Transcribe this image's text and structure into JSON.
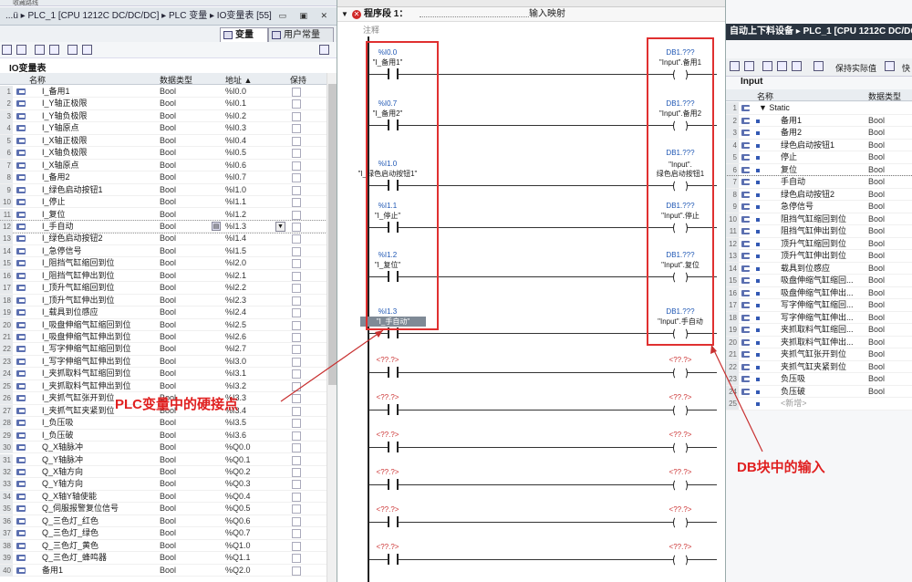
{
  "left_panel": {
    "top_text": "收藏路线",
    "breadcrumb": "...ü ▸ PLC_1 [CPU 1212C DC/DC/DC] ▸ PLC 变量 ▸ IO变量表 [55]",
    "tabs": [
      "变量",
      "用户常量"
    ],
    "table_title": "IO变量表",
    "columns": [
      "名称",
      "数据类型",
      "地址 ▲",
      "保持"
    ],
    "rows": [
      {
        "n": "1",
        "name": "I_备用1",
        "type": "Bool",
        "addr": "%I0.0"
      },
      {
        "n": "2",
        "name": "I_Y轴正极限",
        "type": "Bool",
        "addr": "%I0.1"
      },
      {
        "n": "3",
        "name": "I_Y轴负极限",
        "type": "Bool",
        "addr": "%I0.2"
      },
      {
        "n": "4",
        "name": "I_Y轴原点",
        "type": "Bool",
        "addr": "%I0.3"
      },
      {
        "n": "5",
        "name": "I_X轴正极限",
        "type": "Bool",
        "addr": "%I0.4"
      },
      {
        "n": "6",
        "name": "I_X轴负极限",
        "type": "Bool",
        "addr": "%I0.5"
      },
      {
        "n": "7",
        "name": "I_X轴原点",
        "type": "Bool",
        "addr": "%I0.6"
      },
      {
        "n": "8",
        "name": "I_备用2",
        "type": "Bool",
        "addr": "%I0.7"
      },
      {
        "n": "9",
        "name": "I_绿色启动按钮1",
        "type": "Bool",
        "addr": "%I1.0"
      },
      {
        "n": "10",
        "name": "I_停止",
        "type": "Bool",
        "addr": "%I1.1"
      },
      {
        "n": "11",
        "name": "I_复位",
        "type": "Bool",
        "addr": "%I1.2"
      },
      {
        "n": "12",
        "name": "I_手自动",
        "type": "Bool",
        "addr": "%I1.3"
      },
      {
        "n": "13",
        "name": "I_绿色启动按钮2",
        "type": "Bool",
        "addr": "%I1.4"
      },
      {
        "n": "14",
        "name": "I_急停信号",
        "type": "Bool",
        "addr": "%I1.5"
      },
      {
        "n": "15",
        "name": "I_阻挡气缸缩回到位",
        "type": "Bool",
        "addr": "%I2.0"
      },
      {
        "n": "16",
        "name": "I_阻挡气缸伸出到位",
        "type": "Bool",
        "addr": "%I2.1"
      },
      {
        "n": "17",
        "name": "I_顶升气缸缩回到位",
        "type": "Bool",
        "addr": "%I2.2"
      },
      {
        "n": "18",
        "name": "I_顶升气缸伸出到位",
        "type": "Bool",
        "addr": "%I2.3"
      },
      {
        "n": "19",
        "name": "I_载具到位感应",
        "type": "Bool",
        "addr": "%I2.4"
      },
      {
        "n": "20",
        "name": "I_吸盘伸缩气缸缩回到位",
        "type": "Bool",
        "addr": "%I2.5"
      },
      {
        "n": "21",
        "name": "I_吸盘伸缩气缸伸出到位",
        "type": "Bool",
        "addr": "%I2.6"
      },
      {
        "n": "22",
        "name": "I_写字伸缩气缸缩回到位",
        "type": "Bool",
        "addr": "%I2.7"
      },
      {
        "n": "23",
        "name": "I_写字伸缩气缸伸出到位",
        "type": "Bool",
        "addr": "%I3.0"
      },
      {
        "n": "24",
        "name": "I_夹抓取料气缸缩回到位",
        "type": "Bool",
        "addr": "%I3.1"
      },
      {
        "n": "25",
        "name": "I_夹抓取料气缸伸出到位",
        "type": "Bool",
        "addr": "%I3.2"
      },
      {
        "n": "26",
        "name": "I_夹抓气缸张开到位",
        "type": "Bool",
        "addr": "%I3.3"
      },
      {
        "n": "27",
        "name": "I_夹抓气缸夹紧到位",
        "type": "Bool",
        "addr": "%I3.4"
      },
      {
        "n": "28",
        "name": "I_负压吸",
        "type": "Bool",
        "addr": "%I3.5"
      },
      {
        "n": "29",
        "name": "I_负压破",
        "type": "Bool",
        "addr": "%I3.6"
      },
      {
        "n": "30",
        "name": "Q_X轴脉冲",
        "type": "Bool",
        "addr": "%Q0.0"
      },
      {
        "n": "31",
        "name": "Q_Y轴脉冲",
        "type": "Bool",
        "addr": "%Q0.1"
      },
      {
        "n": "32",
        "name": "Q_X轴方向",
        "type": "Bool",
        "addr": "%Q0.2"
      },
      {
        "n": "33",
        "name": "Q_Y轴方向",
        "type": "Bool",
        "addr": "%Q0.3"
      },
      {
        "n": "34",
        "name": "Q_X轴Y轴使能",
        "type": "Bool",
        "addr": "%Q0.4"
      },
      {
        "n": "35",
        "name": "Q_伺服报警复位信号",
        "type": "Bool",
        "addr": "%Q0.5"
      },
      {
        "n": "36",
        "name": "Q_三色灯_红色",
        "type": "Bool",
        "addr": "%Q0.6"
      },
      {
        "n": "37",
        "name": "Q_三色灯_绿色",
        "type": "Bool",
        "addr": "%Q0.7"
      },
      {
        "n": "38",
        "name": "Q_三色灯_黄色",
        "type": "Bool",
        "addr": "%Q1.0"
      },
      {
        "n": "39",
        "name": "Q_三色灯_蜂鸣器",
        "type": "Bool",
        "addr": "%Q1.1"
      },
      {
        "n": "40",
        "name": "备用1",
        "type": "Bool",
        "addr": "%Q2.0"
      }
    ]
  },
  "editor": {
    "segment_title": "程序段 1：",
    "segment_comment": "输入映射",
    "comment_label": "注释",
    "rungs": [
      {
        "addr": "%I0.0",
        "tag": "\"I_备用1\"",
        "db": "DB1.???",
        "coil": "\"Input\".备用1"
      },
      {
        "addr": "%I0.7",
        "tag": "\"I_备用2\"",
        "db": "DB1.???",
        "coil": "\"Input\".备用2"
      },
      {
        "addr": "%I1.0",
        "tag": "\"I_绿色启动按钮1\"",
        "db": "DB1.???",
        "coil": "\"Input\".\n绿色启动按钮1"
      },
      {
        "addr": "%I1.1",
        "tag": "\"I_停止\"",
        "db": "DB1.???",
        "coil": "\"Input\".停止"
      },
      {
        "addr": "%I1.2",
        "tag": "\"I_复位\"",
        "db": "DB1.???",
        "coil": "\"Input\".复位"
      },
      {
        "addr": "%I1.3",
        "tag": "\"I_手自动\"",
        "db": "DB1.???",
        "coil": "\"Input\".手自动"
      }
    ],
    "placeholder": "<??.?>"
  },
  "right_panel": {
    "header": "自动上下料设备 ▸ PLC_1 [CPU 1212C DC/DC",
    "toolbar_text": "保持实际值",
    "toolbar_text2": "快",
    "table_title": "Input",
    "columns": [
      "名称",
      "数据类型"
    ],
    "rows": [
      {
        "n": "1",
        "name": "▼ Static",
        "type": ""
      },
      {
        "n": "2",
        "name": "备用1",
        "type": "Bool"
      },
      {
        "n": "3",
        "name": "备用2",
        "type": "Bool"
      },
      {
        "n": "4",
        "name": "绿色启动按钮1",
        "type": "Bool"
      },
      {
        "n": "5",
        "name": "停止",
        "type": "Bool"
      },
      {
        "n": "6",
        "name": "复位",
        "type": "Bool"
      },
      {
        "n": "7",
        "name": "手自动",
        "type": "Bool"
      },
      {
        "n": "8",
        "name": "绿色启动按钮2",
        "type": "Bool"
      },
      {
        "n": "9",
        "name": "急停信号",
        "type": "Bool"
      },
      {
        "n": "10",
        "name": "阻挡气缸缩回到位",
        "type": "Bool"
      },
      {
        "n": "11",
        "name": "阻挡气缸伸出到位",
        "type": "Bool"
      },
      {
        "n": "12",
        "name": "顶升气缸缩回到位",
        "type": "Bool"
      },
      {
        "n": "13",
        "name": "顶升气缸伸出到位",
        "type": "Bool"
      },
      {
        "n": "14",
        "name": "载具到位感应",
        "type": "Bool"
      },
      {
        "n": "15",
        "name": "吸盘伸缩气缸缩回...",
        "type": "Bool"
      },
      {
        "n": "16",
        "name": "吸盘伸缩气缸伸出...",
        "type": "Bool"
      },
      {
        "n": "17",
        "name": "写字伸缩气缸缩回...",
        "type": "Bool"
      },
      {
        "n": "18",
        "name": "写字伸缩气缸伸出...",
        "type": "Bool"
      },
      {
        "n": "19",
        "name": "夹抓取料气缸缩回...",
        "type": "Bool"
      },
      {
        "n": "20",
        "name": "夹抓取料气缸伸出...",
        "type": "Bool"
      },
      {
        "n": "21",
        "name": "夹抓气缸张开到位",
        "type": "Bool"
      },
      {
        "n": "22",
        "name": "夹抓气缸夹紧到位",
        "type": "Bool"
      },
      {
        "n": "23",
        "name": "负压吸",
        "type": "Bool"
      },
      {
        "n": "24",
        "name": "负压破",
        "type": "Bool"
      },
      {
        "n": "25",
        "name": "<新增>",
        "type": ""
      }
    ]
  },
  "annotations": {
    "left": "PLC变量中的硬接点",
    "right": "DB块中的输入"
  },
  "colors": {
    "accent_red": "#e02020",
    "blue_text": "#1f57b4",
    "header_dark": "#2a3440"
  }
}
